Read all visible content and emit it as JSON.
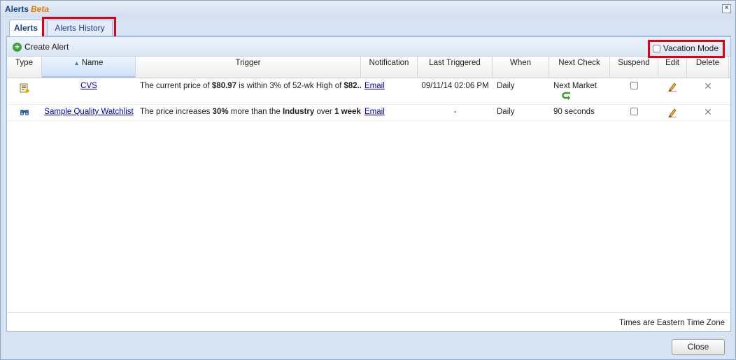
{
  "window": {
    "title": "Alerts",
    "title_badge": "Beta",
    "close_label": "×"
  },
  "tabs": [
    {
      "label": "Alerts",
      "active": true
    },
    {
      "label": "Alerts History",
      "active": false
    }
  ],
  "toolbar": {
    "create_label": "Create Alert",
    "vacation_label": "Vacation Mode"
  },
  "columns": [
    "Type",
    "Name",
    "Trigger",
    "Notification",
    "Last Triggered",
    "When",
    "Next Check",
    "Suspend",
    "Edit",
    "Delete"
  ],
  "rows": [
    {
      "type_icon": "alert-list-icon",
      "name": "CVS",
      "trigger": {
        "t1": "The current price of ",
        "b1": "$80.97",
        "t2": " is within 3% of 52-wk High of ",
        "b2": "$82...."
      },
      "notification": "Email",
      "last_triggered": "09/11/14 02:06 PM",
      "when": "Daily",
      "next_check": "Next Market",
      "next_check_icon": "refresh-arrow-icon"
    },
    {
      "type_icon": "binoculars-icon",
      "name": "Sample Quality Watchlist",
      "trigger": {
        "t1": "The price increases ",
        "b1": "30%",
        "t2": " more than the ",
        "b2": "Industry",
        "t3": " over ",
        "b3": "1 week",
        "t4": "."
      },
      "notification": "Email",
      "last_triggered": "-",
      "when": "Daily",
      "next_check": "90 seconds"
    }
  ],
  "footer": {
    "timezone_note": "Times are Eastern Time Zone",
    "close_label": "Close"
  },
  "colors": {
    "accent": "#15428b",
    "beta": "#e07b00",
    "highlight": "#e00012"
  }
}
